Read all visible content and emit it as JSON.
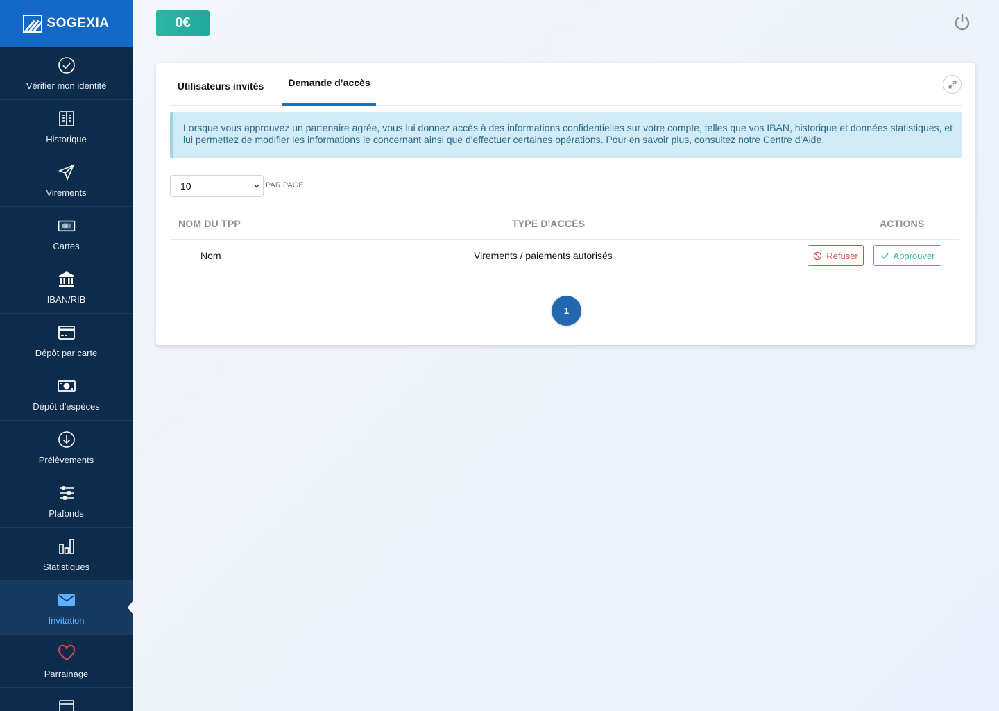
{
  "brand": {
    "name": "SOGEXIA"
  },
  "header": {
    "balance": "0€"
  },
  "sidebar": {
    "items": [
      {
        "label": "Vérifier mon identité",
        "icon": "check-circle-icon"
      },
      {
        "label": "Historique",
        "icon": "book-icon"
      },
      {
        "label": "Virements",
        "icon": "paper-plane-icon"
      },
      {
        "label": "Cartes",
        "icon": "mastercard-icon"
      },
      {
        "label": "IBAN/RIB",
        "icon": "bank-icon"
      },
      {
        "label": "Dépôt par carte",
        "icon": "credit-card-icon"
      },
      {
        "label": "Dépôt d'espèces",
        "icon": "cash-icon"
      },
      {
        "label": "Prélèvements",
        "icon": "arrow-down-circle-icon"
      },
      {
        "label": "Plafonds",
        "icon": "sliders-icon"
      },
      {
        "label": "Statistiques",
        "icon": "bar-chart-icon"
      },
      {
        "label": "Invitation",
        "icon": "envelope-icon",
        "active": true
      },
      {
        "label": "Parrainage",
        "icon": "heart-icon"
      }
    ]
  },
  "tabs": [
    {
      "label": "Utilisateurs invités"
    },
    {
      "label": "Demande d’accès",
      "active": true
    }
  ],
  "info_text": "Lorsque vous approuvez un partenaire agrée, vous lui donnez accès à des informations confidentielles sur votre compte, telles que vos IBAN, historique et données statistiques, et lui permettez de modifier les informations le concernant ainsi que d'effectuer certaines opérations. Pour en savoir plus, consultez notre Centre d'Aide.",
  "per_page": {
    "value": "10",
    "label": "PAR PAGE"
  },
  "table": {
    "headers": [
      "NOM DU TPP",
      "TYPE D'ACCÈS",
      "ACTIONS"
    ],
    "rows": [
      {
        "name": "Nom",
        "type": "Virements / paiements autorisés"
      }
    ],
    "actions": {
      "refuse": "Refuser",
      "approve": "Approuver"
    }
  },
  "pagination": {
    "current": "1"
  },
  "colors": {
    "sidebar": "#0d2c4c",
    "brand": "#1469c7",
    "accent": "#2367b1",
    "teal": "#2bb7a3",
    "danger": "#e34c4c"
  }
}
